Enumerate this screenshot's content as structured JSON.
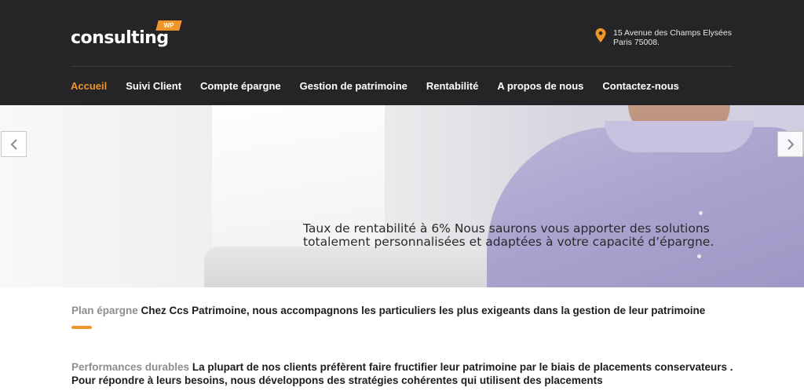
{
  "header": {
    "logo_text": "consulting",
    "logo_badge": "WP",
    "address_line1": "15 Avenue des Champs Elysées",
    "address_line2": "Paris 75008."
  },
  "nav": {
    "items": [
      {
        "label": "Accueil",
        "active": true
      },
      {
        "label": "Suivi Client",
        "active": false
      },
      {
        "label": "Compte épargne",
        "active": false
      },
      {
        "label": "Gestion de patrimoine",
        "active": false
      },
      {
        "label": "Rentabilité",
        "active": false
      },
      {
        "label": "A propos de nous",
        "active": false
      },
      {
        "label": "Contactez-nous",
        "active": false
      }
    ]
  },
  "hero": {
    "caption_line1": "Taux de rentabilité à 6% Nous saurons vous apporter des solutions",
    "caption_line2": "totalement personnalisées et adaptées à votre capacité d’épargne."
  },
  "features": [
    {
      "label": "Plan épargne",
      "text": "Chez Ccs Patrimoine, nous accompagnons les particuliers les plus exigeants dans la gestion de leur patrimoine"
    },
    {
      "label": "Performances durables",
      "text": "La plupart de nos clients préfèrent faire fructifier leur patrimoine par le biais de placements conservateurs . Pour répondre à leurs besoins, nous développons des stratégies cohérentes qui utilisent des placements"
    }
  ],
  "colors": {
    "accent": "#f0952a",
    "header_bg": "#252527",
    "label_gray": "#8e8e8e"
  },
  "icons": {
    "location": "map-pin-icon",
    "prev": "chevron-left-icon",
    "next": "chevron-right-icon"
  }
}
